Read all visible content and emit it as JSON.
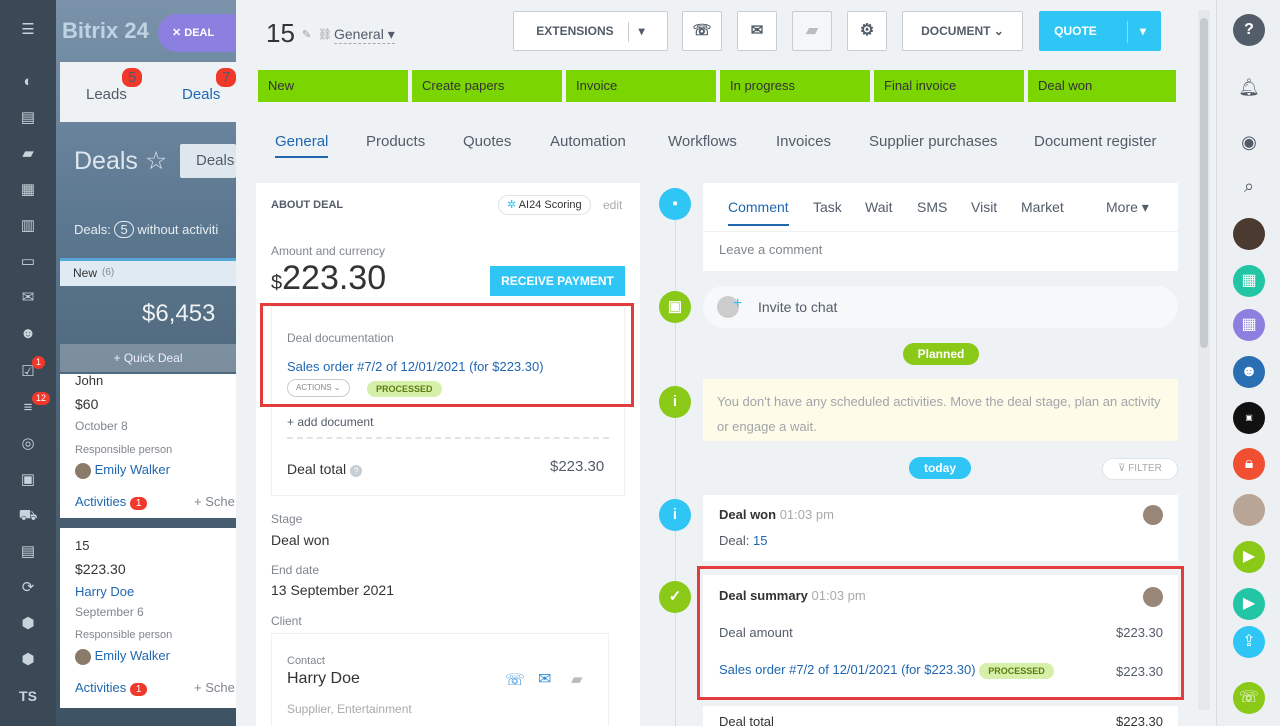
{
  "app": {
    "logo": "Bitrix 24",
    "deal_pill": "DEAL",
    "tab_leads": "Leads",
    "leads_count": "5",
    "tab_deals": "Deals",
    "deals_count": "7",
    "page_title": "Deals",
    "deals_btn": "Deals",
    "deals_summary": "Deals:",
    "deals_summary_count": "5",
    "deals_summary_rest": "without activiti",
    "column": "New",
    "column_count": "(6)",
    "column_sum": "$6,453",
    "quick_deal": "+ Quick Deal",
    "nav_badge1": "1",
    "nav_badge2": "12",
    "nav_user": "TS"
  },
  "kanban": [
    {
      "name": "John",
      "amount": "$60",
      "date": "October 8",
      "resp_label": "Responsible person",
      "resp": "Emily Walker",
      "activities": "Activities",
      "act_count": "1",
      "sched": "+ Sche"
    },
    {
      "name": "15",
      "amount": "$223.30",
      "client": "Harry Doe",
      "date": "September 6",
      "resp_label": "Responsible person",
      "resp": "Emily Walker",
      "activities": "Activities",
      "act_count": "1",
      "sched": "+ Sche"
    }
  ],
  "header": {
    "deal_id": "15",
    "category": "General",
    "extensions": "EXTENSIONS",
    "document": "DOCUMENT",
    "quote": "QUOTE"
  },
  "stages": [
    "New",
    "Create papers",
    "Invoice",
    "In progress",
    "Final invoice",
    "Deal won"
  ],
  "tabs": [
    "General",
    "Products",
    "Quotes",
    "Automation",
    "Workflows",
    "Invoices",
    "Supplier purchases",
    "Document register"
  ],
  "about": {
    "title": "ABOUT DEAL",
    "scoring": "AI24 Scoring",
    "edit": "edit",
    "amount_label": "Amount and currency",
    "currency": "$",
    "amount": "223.30",
    "receive_payment": "RECEIVE PAYMENT",
    "doc_label": "Deal documentation",
    "doc_link": "Sales order #7/2 of 12/01/2021 (for $223.30)",
    "actions": "ACTIONS",
    "processed": "PROCESSED",
    "add_doc": "+ add document",
    "total_label": "Deal total",
    "total_value": "$223.30",
    "stage_label": "Stage",
    "stage_value": "Deal won",
    "end_label": "End date",
    "end_value": "13 September 2021",
    "client_label": "Client",
    "contact_label": "Contact",
    "contact_name": "Harry Doe",
    "contact_sub": "Supplier, Entertainment"
  },
  "timeline": {
    "tabs": [
      "Comment",
      "Task",
      "Wait",
      "SMS",
      "Visit",
      "Market",
      "More"
    ],
    "placeholder": "Leave a comment",
    "invite": "Invite to chat",
    "planned": "Planned",
    "planned_text": "You don't have any scheduled activities. Move the deal stage, plan an activity or engage a wait.",
    "today": "today",
    "filter": "FILTER",
    "won_title": "Deal won",
    "won_time": "01:03 pm",
    "won_deal_label": "Deal:",
    "won_deal_id": "15",
    "summary_title": "Deal summary",
    "summary_time": "01:03 pm",
    "amount_label": "Deal amount",
    "amount_value": "$223.30",
    "order_link": "Sales order #7/2 of 12/01/2021 (for $223.30)",
    "order_status": "PROCESSED",
    "order_value": "$223.30",
    "total_label": "Deal total",
    "total_value": "$223.30"
  },
  "colors": {
    "stage_green": "#7bd500",
    "accent_blue": "#2fc6f6",
    "link": "#2067b0",
    "highlight_red": "#e23c3c"
  }
}
